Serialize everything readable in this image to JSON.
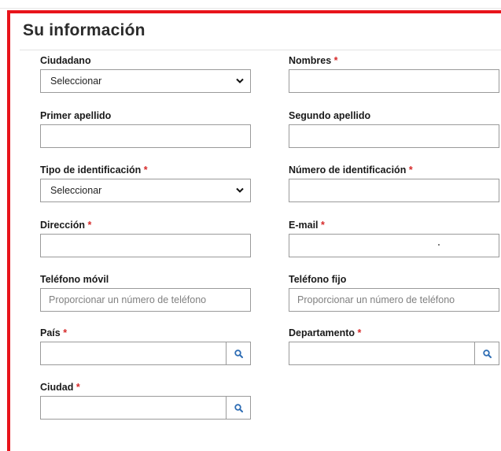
{
  "form": {
    "title": "Su información",
    "required_mark": "*",
    "ciudadano": {
      "label": "Ciudadano",
      "selected": "Seleccionar"
    },
    "nombres": {
      "label": "Nombres",
      "value": ""
    },
    "primer_apellido": {
      "label": "Primer apellido",
      "value": ""
    },
    "segundo_apellido": {
      "label": "Segundo apellido",
      "value": ""
    },
    "tipo_identificacion": {
      "label": "Tipo de identificación",
      "selected": "Seleccionar"
    },
    "numero_identificacion": {
      "label": "Número de identificación",
      "value": ""
    },
    "direccion": {
      "label": "Dirección",
      "value": ""
    },
    "email": {
      "label": "E-mail",
      "value": ""
    },
    "telefono_movil": {
      "label": "Teléfono móvil",
      "placeholder": "Proporcionar un número de teléfono"
    },
    "telefono_fijo": {
      "label": "Teléfono fijo",
      "placeholder": "Proporcionar un número de teléfono"
    },
    "pais": {
      "label": "País",
      "value": "",
      "icon": "search-icon"
    },
    "departamento": {
      "label": "Departamento",
      "value": "",
      "icon": "search-icon"
    },
    "ciudad": {
      "label": "Ciudad",
      "value": "",
      "icon": "search-icon"
    }
  },
  "colors": {
    "panel_border": "#e8141b",
    "required": "#d62a2a",
    "lookup_icon": "#2e6db4"
  }
}
